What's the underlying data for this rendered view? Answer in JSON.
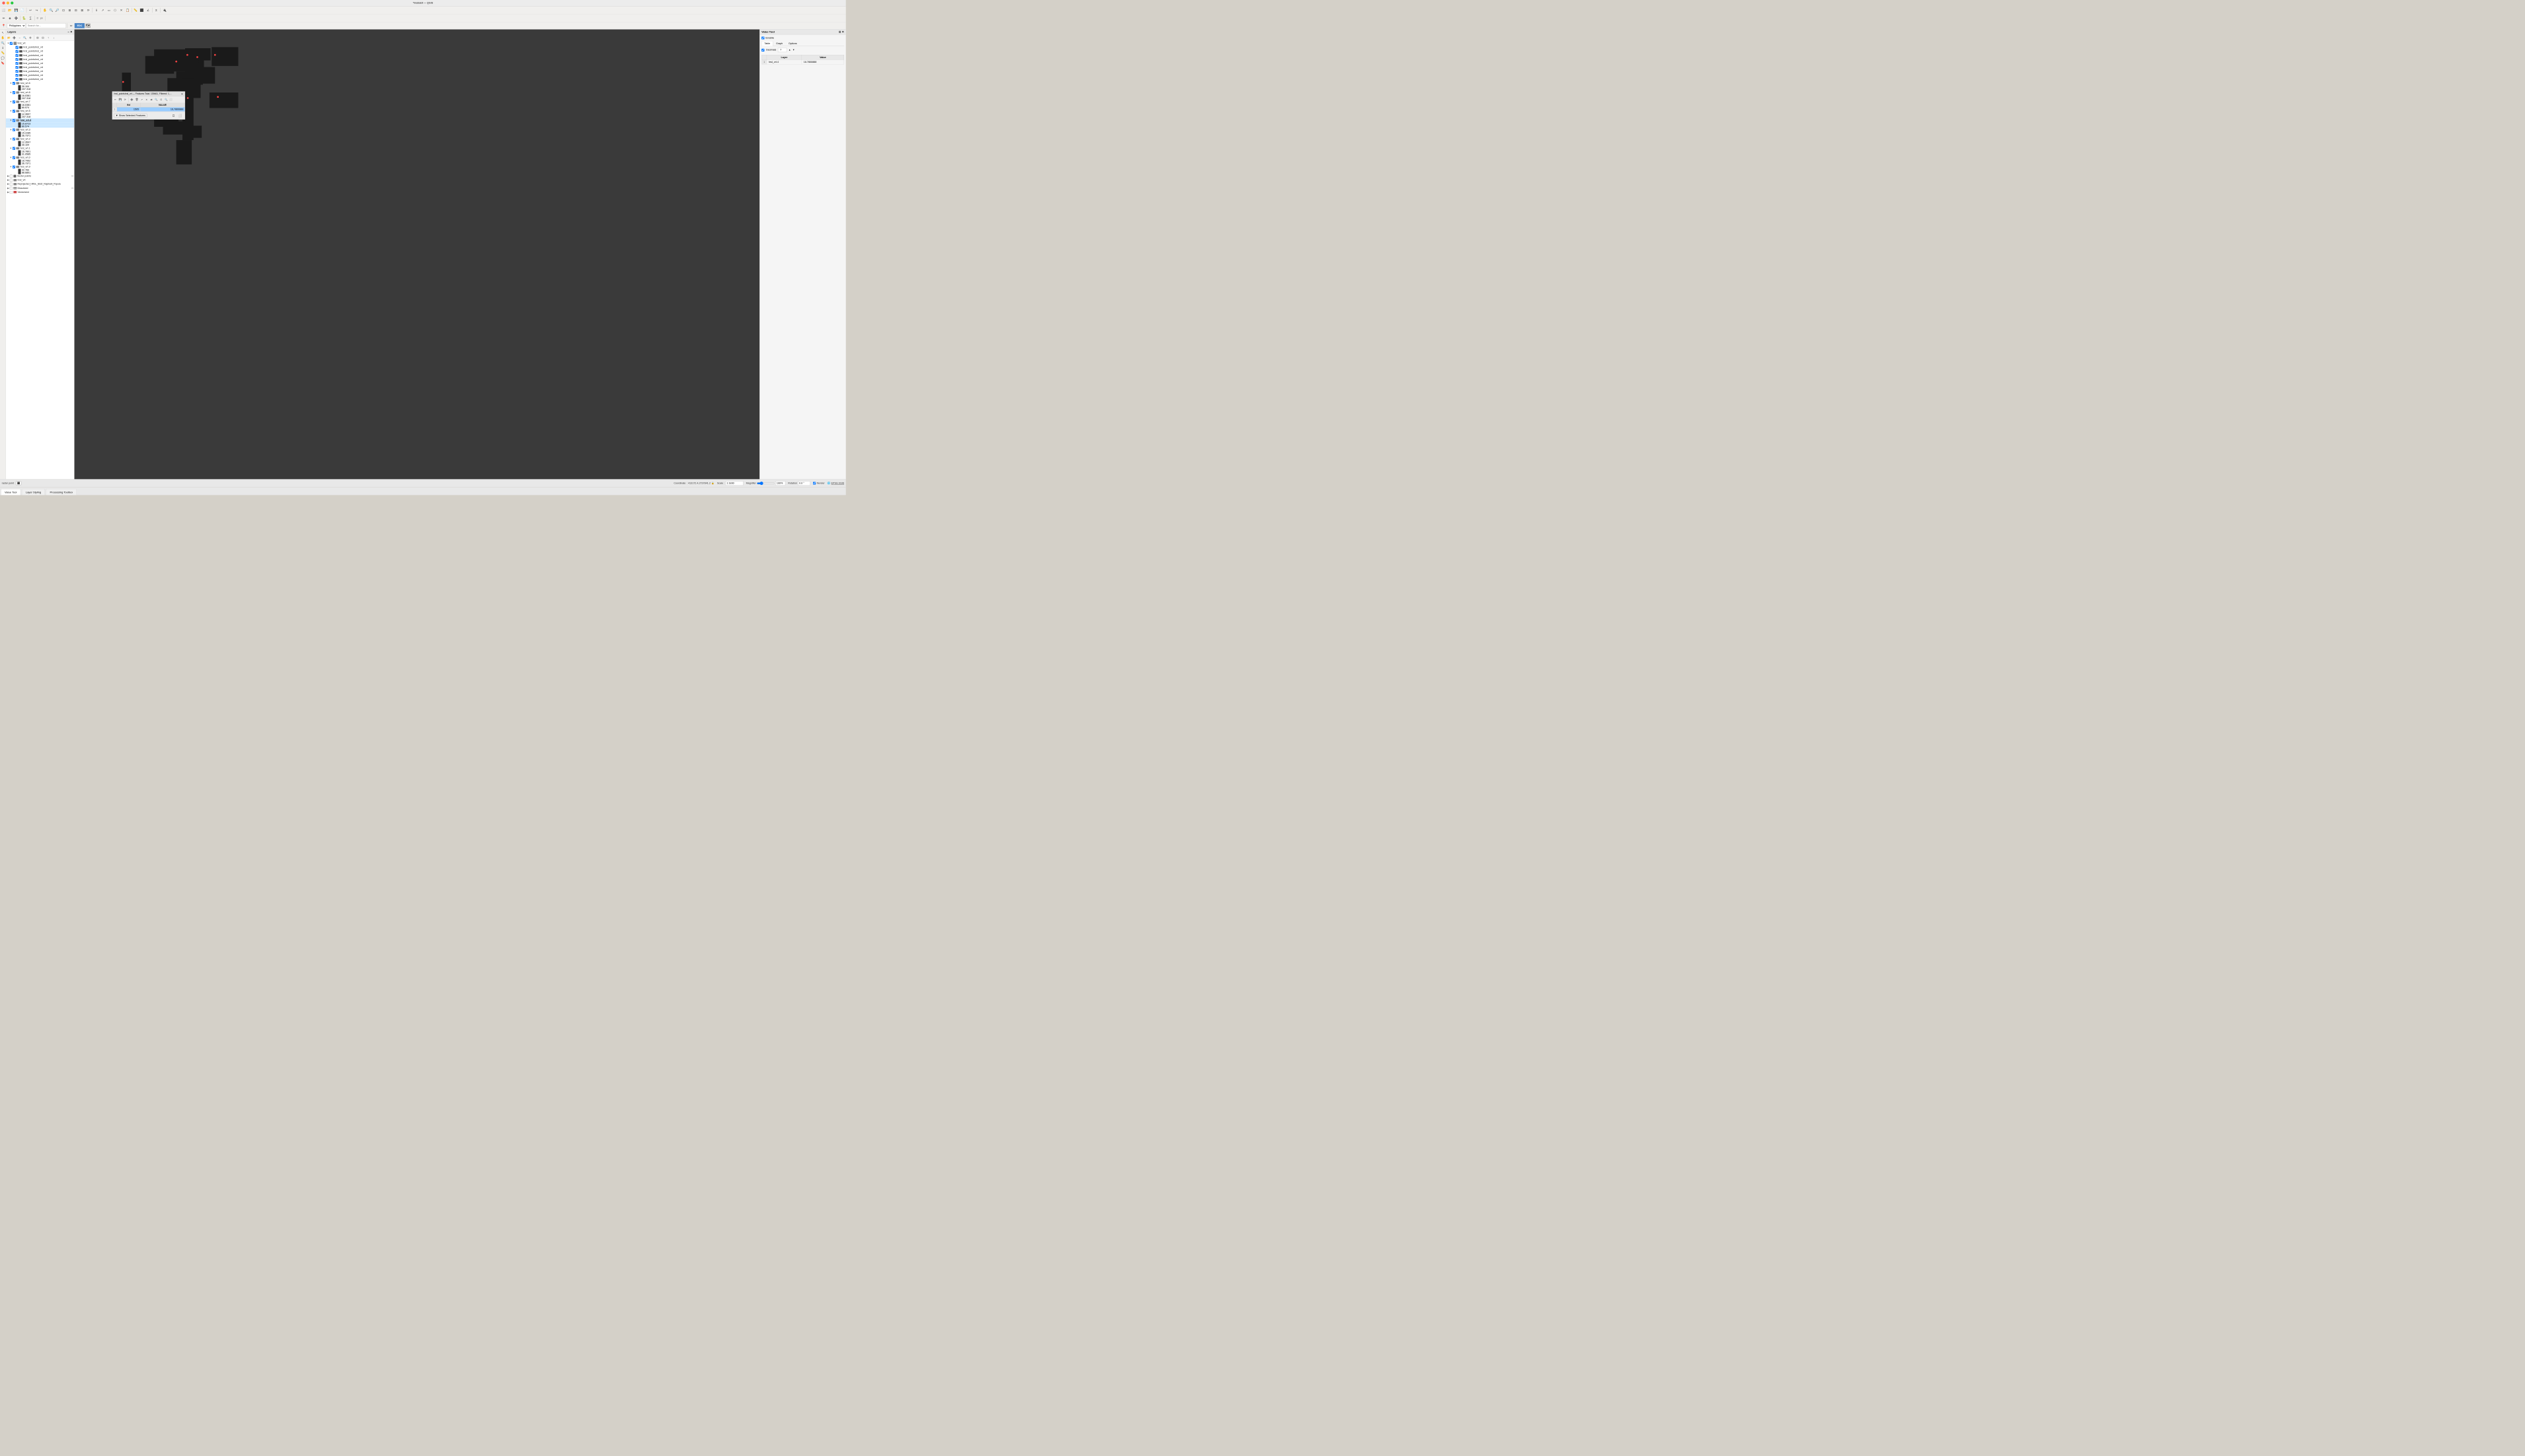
{
  "titlebar": {
    "title": "*module9 — QGIS"
  },
  "toolbar": {
    "rows": [
      {
        "icons": [
          "📁",
          "💾",
          "🖨",
          "✂",
          "📋",
          "↩",
          "↪",
          "🔍",
          "🔍",
          "🔍",
          "🔍",
          "🔍",
          "🔍",
          "🔍",
          "⟳",
          "💡"
        ]
      },
      {
        "icons": [
          "✏",
          "📐",
          "📏",
          "🔤",
          "🎨",
          "📊"
        ]
      },
      {
        "icons": [
          "🗺",
          "📍",
          "🔧"
        ]
      }
    ]
  },
  "layers_panel": {
    "title": "Layers",
    "items": [
      {
        "name": "hrsl_vrt",
        "type": "group",
        "expanded": true,
        "children": [
          {
            "name": "hrsl_pointshrsl_vrt",
            "checked": true
          },
          {
            "name": "hrsl_pointshrsl_vrt",
            "checked": true
          },
          {
            "name": "hrsl_pointshrsl_vrt",
            "checked": true
          },
          {
            "name": "hrsl_pointshrsl_vrt",
            "checked": true
          },
          {
            "name": "hrsl_pointshrsl_vrt",
            "checked": true
          },
          {
            "name": "hrsl_pointshrsl_vrt",
            "checked": true
          },
          {
            "name": "hrsl_pointshrsl_vrt",
            "checked": true
          },
          {
            "name": "hrsl_pointshrsl_vrt",
            "checked": true
          },
          {
            "name": "hrsl_pointshrsl_vrt",
            "checked": true
          }
        ]
      },
      {
        "name": "hrsl_vrt.6",
        "type": "raster",
        "checked": true,
        "values": [
          "30.104",
          "207.318"
        ]
      },
      {
        "name": "hrsl_vrt.8",
        "type": "raster",
        "checked": true,
        "values": [
          "16.0381",
          "207.318"
        ]
      },
      {
        "name": "hrsl_vrt.7",
        "type": "raster",
        "checked": true,
        "values": [
          "16.0381",
          "80.574"
        ]
      },
      {
        "name": "hrsl_vrt.5",
        "type": "raster",
        "checked": true,
        "values": [
          "12.3597",
          "207.318"
        ]
      },
      {
        "name": "hrsl_vrt.4",
        "type": "raster",
        "checked": true,
        "values": [
          "15.8723",
          "80.574"
        ],
        "selected": true
      },
      {
        "name": "hrsl_vrt.3",
        "type": "raster",
        "checked": true,
        "values": [
          "15.2285",
          "36.7371"
        ]
      },
      {
        "name": "hrsl_vrt.2",
        "type": "raster",
        "checked": true,
        "values": [
          "12.3597",
          "30.104"
        ]
      },
      {
        "name": "hrsl_vrt.1",
        "type": "raster",
        "checked": true,
        "values": [
          "16.7801",
          "31.0585"
        ]
      },
      {
        "name": "hrsl_vrt.0",
        "type": "raster",
        "checked": true,
        "values": [
          "16.7952",
          "36.7371"
        ]
      },
      {
        "name": "hrsl_vrt.9",
        "type": "raster",
        "checked": true,
        "values": [
          "32.783",
          "88.6801"
        ]
      },
      {
        "name": "Vector points",
        "type": "vector"
      },
      {
        "name": "hrsl_vrt",
        "type": "raster"
      },
      {
        "name": "Reprojected_HRSL_BGD_Rajshahi_Popula",
        "type": "raster"
      },
      {
        "name": "Dissolved",
        "type": "poly-gray"
      },
      {
        "name": "Vectorized",
        "type": "poly-red"
      }
    ]
  },
  "feature_table": {
    "title": "hrsl_pointshrsl_vrt — Features Total: 139461, Filtered: 1,...",
    "columns": [
      "fid",
      "VALUE"
    ],
    "rows": [
      {
        "num": "1",
        "fid": "1505",
        "value": "16,7800888"
      }
    ],
    "footer": {
      "show_selected_label": "Show Selected Features"
    }
  },
  "value_tool": {
    "title": "Value Tool",
    "enable_label": "Enable",
    "tabs": [
      "Table",
      "Graph",
      "Options"
    ],
    "active_tab": "Table",
    "decimals_label": "Decimals",
    "decimals_value": "7",
    "table_headers": [
      "Layer",
      "Value"
    ],
    "rows": [
      {
        "num": "1",
        "layer": "hrsl_vrt.4",
        "value": "16.7800888"
      }
    ]
  },
  "status_bar": {
    "left_text": "raster point",
    "coordinate_label": "Coordinate",
    "coordinate_value": "413172.4,2737841.2",
    "scale_label": "Scale",
    "scale_value": "1:1830",
    "magnifier_label": "Magnifier",
    "magnifier_value": "100%",
    "rotation_label": "Rotation",
    "rotation_value": "0.0 °",
    "render_label": "Render",
    "epsg_value": "EPSG:3106"
  },
  "bottom_tabs": [
    {
      "label": "Value Tool",
      "active": true
    },
    {
      "label": "Layer Styling",
      "active": false
    },
    {
      "label": "Processing Toolbox",
      "active": false
    }
  ],
  "location_bar": {
    "location": "Philippines",
    "search_placeholder": "Search for...",
    "edc_label": "EDC"
  }
}
